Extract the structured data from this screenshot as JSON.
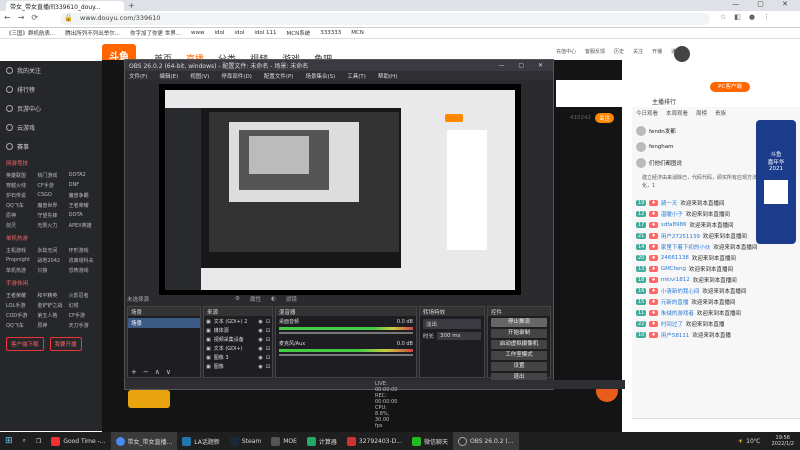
{
  "browser": {
    "tab_title": "带女_带女直播间339610_douy...",
    "url": "www.douyu.com/339610",
    "bookmarks": [
      "《三国》群机航表...",
      "腾出所列不列出举尔...",
      "你字加了你更 世界...",
      "www",
      "idol",
      "idol",
      "idol 111",
      "MCN系统",
      "333333",
      "MCN"
    ]
  },
  "douyu": {
    "logo": "斗鱼",
    "nav": [
      "首页",
      "直播",
      "分类",
      "视频",
      "游戏",
      "鱼吧"
    ],
    "pc_button": "PC客户端",
    "toolbar": [
      "充值中心",
      "客服反馈",
      "历史",
      "关注",
      "开播",
      "通知",
      "中心"
    ]
  },
  "sidebar": {
    "items": [
      "我的关注",
      "排行榜",
      "页游中心",
      "云游戏",
      "赛事"
    ],
    "section1": "网游竞技",
    "games1": [
      "英雄联盟",
      "热门游戏",
      "DOTA2",
      "穿越火线",
      "CF手游",
      "DNF",
      "炉石传说",
      "CSGO",
      "魔兽争霸",
      "QQ飞车",
      "魔兽世界",
      "王者荣耀",
      "原神",
      "守望先锋",
      "DOTA",
      "剑灵",
      "无限火力",
      "APEX英雄"
    ],
    "section2": "单机热游",
    "games2": [
      "主机游戏",
      "永劫无间",
      "环形游戏",
      "Propnight",
      "战地2042",
      "逃离塔科夫",
      "单机热游",
      "只狼",
      "恐怖游戏"
    ],
    "section3": "手游休闲",
    "games3": [
      "王者荣耀",
      "和平精英",
      "火影忍者",
      "LOL手游",
      "金铲铲之战",
      "幻塔",
      "COD手游",
      "第五人格",
      "CF手游",
      "QQ飞车",
      "原神",
      "天刀手游"
    ],
    "bottom_buttons": [
      "客户端下载",
      "我要开播"
    ]
  },
  "obs": {
    "title": "OBS 26.0.2 (64-bit, windows) - 配置文件: 未命名 - 场景: 未命名",
    "menu": [
      "文件(F)",
      "编辑(E)",
      "视图(V)",
      "停靠部件(D)",
      "配置文件(P)",
      "场景集合(S)",
      "工具(T)",
      "帮助(H)"
    ],
    "no_source": "未选择源",
    "props": "属性",
    "filters": "滤镜",
    "docks": [
      "场景",
      "来源",
      "混音器",
      "转场特效",
      "控件"
    ],
    "scene": "场景",
    "sources": [
      "文本 (GDI+) 2",
      "媒体源",
      "视频采集设备",
      "文本 (GDI+)",
      "图像 3",
      "图像"
    ],
    "mixer": [
      "桌面音频",
      "麦克风/Aux"
    ],
    "mixer_db": [
      "0.0 dB",
      "0.0 dB"
    ],
    "transition": "淡出",
    "duration_label": "时长",
    "duration": "300 ms",
    "controls": [
      "停止推流",
      "开始录制",
      "启动虚拟摄像机",
      "工作室模式",
      "设置",
      "退出"
    ],
    "status": "LIVE: 00:00:00   REC: 00:00:00   CPU: 8.8%, 30.00 fps"
  },
  "chat": {
    "tabs": [
      "今日观看",
      "本周观看",
      "周榜",
      "贵族"
    ],
    "rank_title": "主播排行",
    "follow_label": "关注",
    "follow_count": "410242",
    "notice": "建立经济由来消除已，代码代码，即买所有应现方法，和直接可能化，1",
    "top_users": [
      {
        "name": "fendn发都",
        "tag": "已满员"
      },
      {
        "name": "fengham",
        "tag": "已满员"
      },
      {
        "name": "们他们都图说",
        "tag": "已满员"
      }
    ],
    "messages": [
      {
        "lvl": "19",
        "user": "骑一天",
        "text": "欢迎来到本直播间"
      },
      {
        "lvl": "12",
        "user": "温暖小子",
        "text": "欢迎来到本直播间"
      },
      {
        "lvl": "17",
        "user": "sdfa8986",
        "text": "欢迎来到本直播间"
      },
      {
        "lvl": "21",
        "user": "用户27251139",
        "text": "欢迎来到本直播间"
      },
      {
        "lvl": "14",
        "user": "家里下着下初的小伙",
        "text": "欢迎来到本直播间"
      },
      {
        "lvl": "20",
        "user": "24661138",
        "text": "欢迎来到本直播间"
      },
      {
        "lvl": "13",
        "user": "GMCfeng",
        "text": "欢迎来到本直播间"
      },
      {
        "lvl": "18",
        "user": "mkivi1812",
        "text": "欢迎来到本直播间"
      },
      {
        "lvl": "16",
        "user": "小清新的我心间",
        "text": "欢迎来到本直播间"
      },
      {
        "lvl": "15",
        "user": "元新的直播",
        "text": "欢迎来到本直播间"
      },
      {
        "lvl": "11",
        "user": "朱绒的游戏者",
        "text": "欢迎来到本直播间"
      },
      {
        "lvl": "22",
        "user": "时间过了",
        "text": "欢迎来到本直播"
      },
      {
        "lvl": "10",
        "user": "用户58111",
        "text": "欢迎来到本直播"
      }
    ],
    "promo": [
      "斗鱼",
      "嘉年华",
      "2021"
    ]
  },
  "taskbar": {
    "items": [
      "Good Time -...",
      "带女_带女直播...",
      "LA话题新",
      "Steam",
      "MOE",
      "计算器",
      "32792403-D...",
      "微信聊天",
      "OBS 26.0.2 (..."
    ],
    "weather": "10℃",
    "time": "19:56",
    "date": "2022/1/2"
  }
}
